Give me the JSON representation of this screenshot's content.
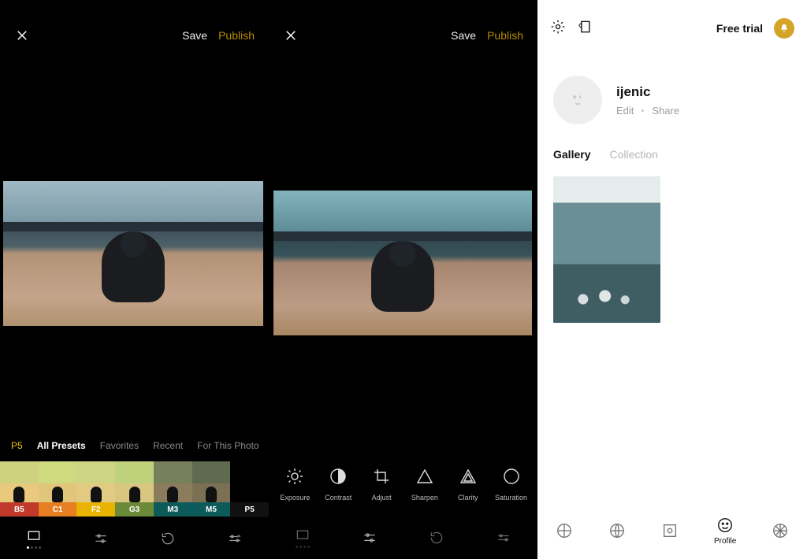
{
  "panel1": {
    "header": {
      "save": "Save",
      "publish": "Publish"
    },
    "categories": {
      "current": "P5",
      "all": "All Presets",
      "favorites": "Favorites",
      "recent": "Recent",
      "forThis": "For This Photo"
    },
    "filters": [
      "B5",
      "C1",
      "F2",
      "G3",
      "M3",
      "M5",
      "P5"
    ]
  },
  "panel2": {
    "header": {
      "save": "Save",
      "publish": "Publish"
    },
    "tools": {
      "exposure": "Exposure",
      "contrast": "Contrast",
      "adjust": "Adjust",
      "sharpen": "Sharpen",
      "clarity": "Clarity",
      "saturation": "Saturation"
    }
  },
  "panel3": {
    "freeTrial": "Free trial",
    "username": "ijenic",
    "edit": "Edit",
    "share": "Share",
    "tabs": {
      "gallery": "Gallery",
      "collection": "Collection"
    },
    "nav": {
      "profile": "Profile"
    }
  }
}
